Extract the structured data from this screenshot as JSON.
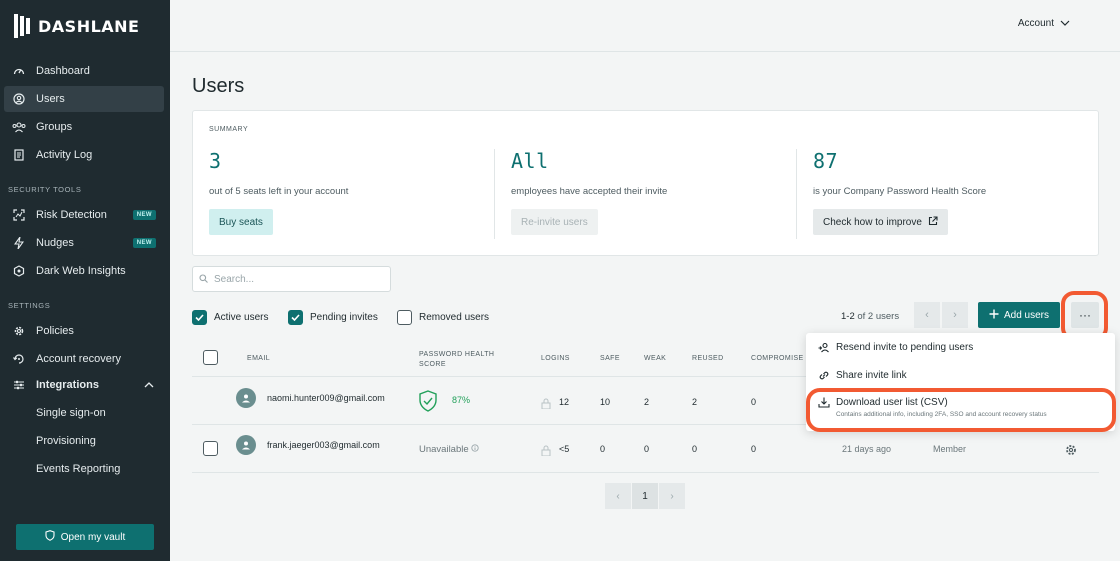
{
  "brand": {
    "name": "DASHLANE"
  },
  "sidebar": {
    "items": [
      {
        "label": "Dashboard",
        "icon": "gauge-icon"
      },
      {
        "label": "Users",
        "icon": "user-circle-icon"
      },
      {
        "label": "Groups",
        "icon": "group-icon"
      },
      {
        "label": "Activity Log",
        "icon": "document-icon"
      }
    ],
    "security_heading": "SECURITY TOOLS",
    "security_items": [
      {
        "label": "Risk Detection",
        "badge": "NEW"
      },
      {
        "label": "Nudges",
        "badge": "NEW"
      },
      {
        "label": "Dark Web Insights"
      }
    ],
    "settings_heading": "SETTINGS",
    "settings_items": [
      {
        "label": "Policies"
      },
      {
        "label": "Account recovery"
      },
      {
        "label": "Integrations"
      }
    ],
    "integration_sub": [
      "Single sign-on",
      "Provisioning",
      "Events Reporting"
    ],
    "vault_button": "Open my vault"
  },
  "header": {
    "account_label": "Account"
  },
  "page": {
    "title": "Users"
  },
  "summary": {
    "label": "SUMMARY",
    "stats": [
      {
        "value": "3",
        "desc": "out of 5 seats left in your account",
        "button": "Buy seats"
      },
      {
        "value": "All",
        "desc": "employees have accepted their invite",
        "button": "Re-invite users"
      },
      {
        "value": "87",
        "desc": "is your Company Password Health Score",
        "button": "Check how to improve"
      }
    ]
  },
  "search": {
    "placeholder": "Search..."
  },
  "filters": {
    "active": "Active users",
    "pending": "Pending invites",
    "removed": "Removed users"
  },
  "pager": {
    "range": "1-2",
    "of_text": "of 2 users"
  },
  "actions": {
    "add_users": "Add users",
    "more": "···"
  },
  "table": {
    "headers": {
      "email": "EMAIL",
      "health": "PASSWORD HEALTH",
      "health2": "SCORE",
      "logins": "LOGINS",
      "safe": "SAFE",
      "weak": "WEAK",
      "reused": "REUSED",
      "compromised": "COMPROMISE"
    },
    "rows": [
      {
        "email": "naomi.hunter009@gmail.com",
        "health": "87%",
        "logins": "12",
        "safe": "10",
        "weak": "2",
        "reused": "2",
        "compromised": "0"
      },
      {
        "email": "frank.jaeger003@gmail.com",
        "health": "Unavailable",
        "logins": "<5",
        "safe": "0",
        "weak": "0",
        "reused": "0",
        "compromised": "0",
        "last_login": "21 days ago",
        "role": "Member"
      }
    ]
  },
  "menu": {
    "resend": "Resend invite to pending users",
    "share": "Share invite link",
    "download": "Download user list (CSV)",
    "download_sub": "Contains additional info, including 2FA, SSO and account recovery status"
  },
  "bottom_pager": {
    "page": "1"
  },
  "colors": {
    "teal": "#0e7070",
    "sidebar": "#1f2b30",
    "highlight": "#f25a32"
  }
}
